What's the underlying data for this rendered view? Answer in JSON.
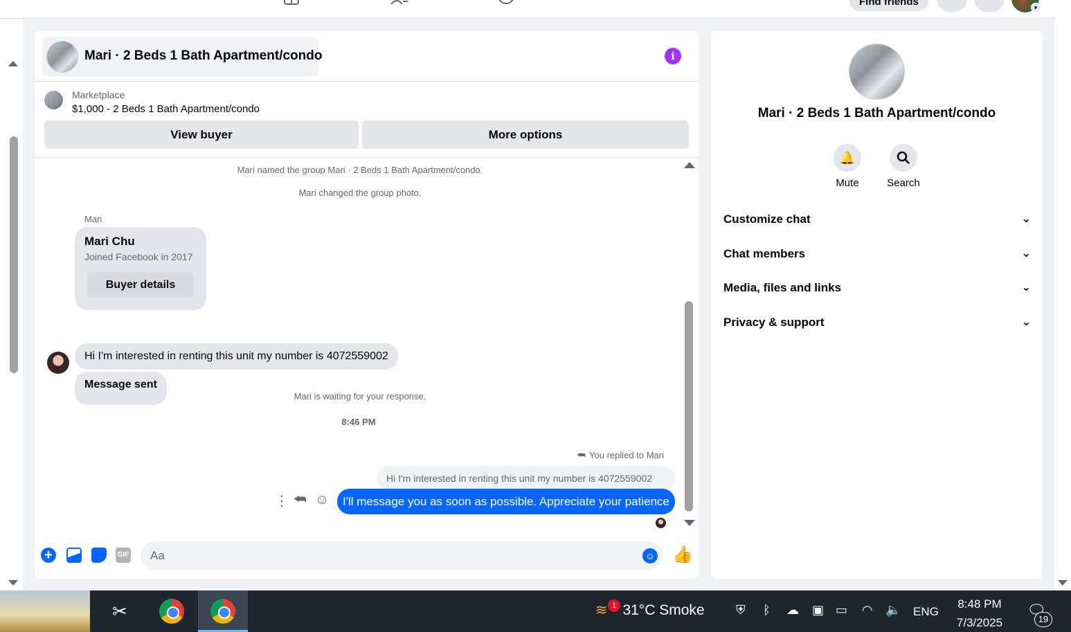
{
  "topbar": {
    "find_friends": "Find friends",
    "icons": [
      "gaming-icon",
      "groups-icon",
      "profile-icon",
      "menu-grid-icon",
      "notifications-icon"
    ]
  },
  "chat": {
    "title": "Mari · 2 Beds 1 Bath Apartment/condo",
    "info_icon": "info-icon",
    "marketplace_label": "Marketplace",
    "listing": "$1,000 - 2 Beds 1 Bath Apartment/condo",
    "view_buyer": "View buyer",
    "more_options": "More options",
    "system_messages": [
      "Mari named the group Mari · 2 Beds 1 Bath Apartment/condo.",
      "Mari changed the group photo."
    ],
    "sender": "Mari",
    "card": {
      "name": "Mari Chu",
      "joined": "Joined Facebook in 2017",
      "button": "Buyer details"
    },
    "incoming": [
      "Hi I'm interested in renting this unit my number is 4072559002",
      "Message sent"
    ],
    "waiting": "Mari is waiting for your response.",
    "time": "8:46 PM",
    "replied_label": "You replied to Mari",
    "quoted": "Hi I'm interested in renting this unit my number is 4072559002",
    "outgoing": "I'll message you as soon as possible. Appreciate your patience",
    "composer_placeholder": "Aa",
    "gif_label": "GIF"
  },
  "right_panel": {
    "title": "Mari · 2 Beds 1 Bath Apartment/condo",
    "actions": [
      {
        "label": "Mute",
        "icon": "bell-icon"
      },
      {
        "label": "Search",
        "icon": "search-icon"
      }
    ],
    "sections": [
      "Customize chat",
      "Chat members",
      "Media, files and links",
      "Privacy & support"
    ]
  },
  "taskbar": {
    "weather_badge": "1",
    "weather": "31°C  Smoke",
    "language": "ENG",
    "time": "8:48 PM",
    "date": "7/3/2025",
    "notifications": "19"
  }
}
